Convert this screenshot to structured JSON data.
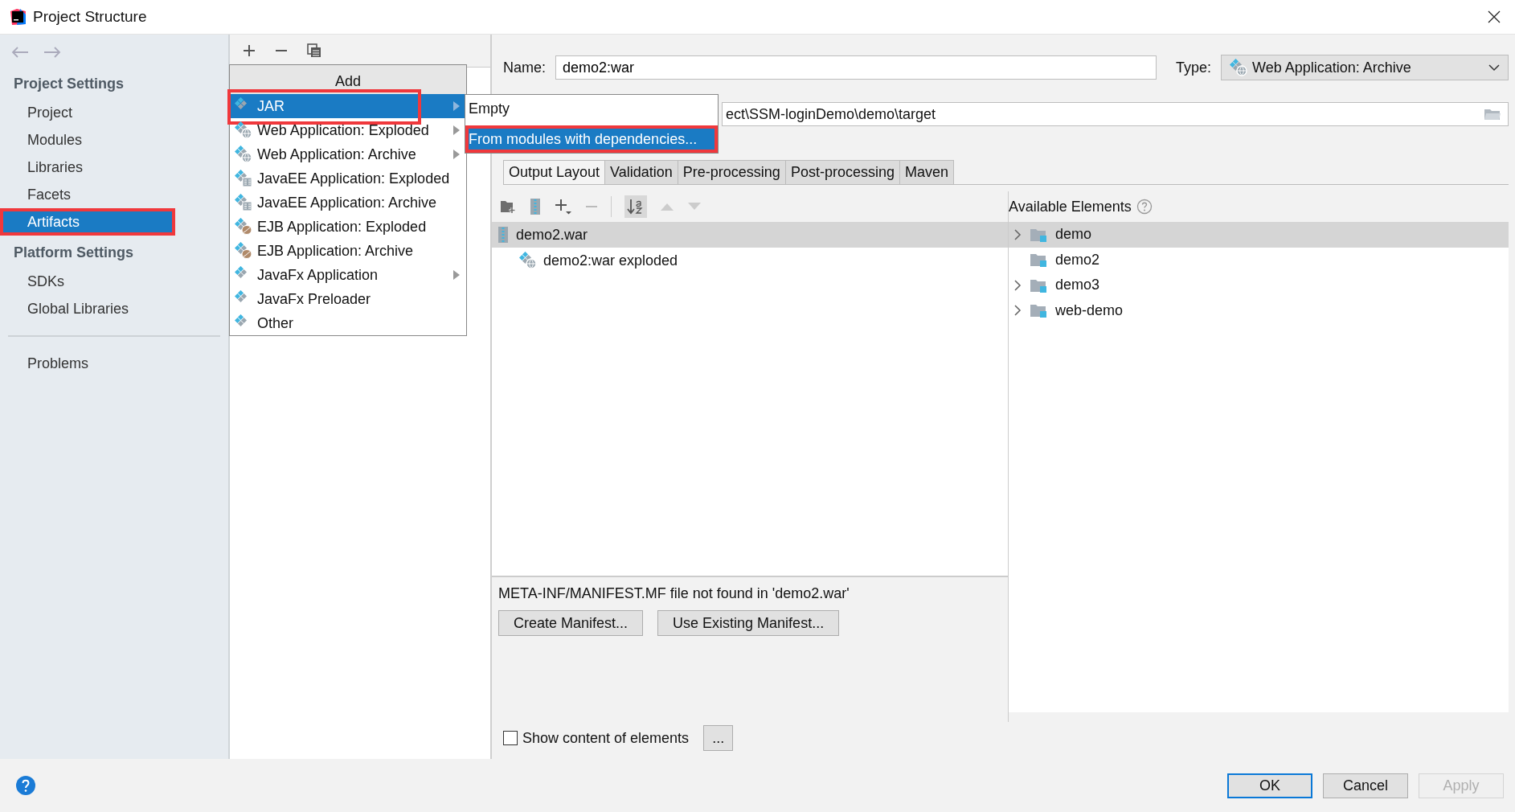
{
  "window": {
    "title": "Project Structure"
  },
  "sidebar": {
    "groups": [
      {
        "heading": "Project Settings",
        "items": [
          {
            "label": "Project",
            "selected": false,
            "highlighted": false
          },
          {
            "label": "Modules",
            "selected": false,
            "highlighted": false
          },
          {
            "label": "Libraries",
            "selected": false,
            "highlighted": false
          },
          {
            "label": "Facets",
            "selected": false,
            "highlighted": false
          },
          {
            "label": "Artifacts",
            "selected": true,
            "highlighted": true
          }
        ]
      },
      {
        "heading": "Platform Settings",
        "items": [
          {
            "label": "SDKs",
            "selected": false,
            "highlighted": false
          },
          {
            "label": "Global Libraries",
            "selected": false,
            "highlighted": false
          }
        ]
      }
    ],
    "footer_items": [
      {
        "label": "Problems",
        "selected": false,
        "highlighted": false
      }
    ]
  },
  "add_popup": {
    "header": "Add",
    "items": [
      {
        "label": "JAR",
        "kind": "jar",
        "submenu": true,
        "selected": true,
        "highlighted": true
      },
      {
        "label": "Web Application: Exploded",
        "kind": "web",
        "submenu": true,
        "selected": false,
        "highlighted": false
      },
      {
        "label": "Web Application: Archive",
        "kind": "web",
        "submenu": true,
        "selected": false,
        "highlighted": false
      },
      {
        "label": "JavaEE Application: Exploded",
        "kind": "javaee",
        "submenu": false,
        "selected": false,
        "highlighted": false
      },
      {
        "label": "JavaEE Application: Archive",
        "kind": "javaee",
        "submenu": false,
        "selected": false,
        "highlighted": false
      },
      {
        "label": "EJB Application: Exploded",
        "kind": "ejb",
        "submenu": false,
        "selected": false,
        "highlighted": false
      },
      {
        "label": "EJB Application: Archive",
        "kind": "ejb",
        "submenu": false,
        "selected": false,
        "highlighted": false
      },
      {
        "label": "JavaFx Application",
        "kind": "jar",
        "submenu": true,
        "selected": false,
        "highlighted": false
      },
      {
        "label": "JavaFx Preloader",
        "kind": "jar",
        "submenu": false,
        "selected": false,
        "highlighted": false
      },
      {
        "label": "Other",
        "kind": "jar",
        "submenu": false,
        "selected": false,
        "highlighted": false
      }
    ]
  },
  "submenu": {
    "items": [
      {
        "label": "Empty",
        "selected": false,
        "highlighted": false
      },
      {
        "label": "From modules with dependencies...",
        "selected": true,
        "highlighted": true
      }
    ]
  },
  "editor": {
    "name_label": "Name:",
    "name_value": "demo2:war",
    "type_label": "Type:",
    "type_value": "Web Application: Archive",
    "output_directory": "ect\\SSM-loginDemo\\demo\\target",
    "tabs": [
      {
        "label": "Output Layout",
        "selected": true
      },
      {
        "label": "Validation",
        "selected": false
      },
      {
        "label": "Pre-processing",
        "selected": false
      },
      {
        "label": "Post-processing",
        "selected": false
      },
      {
        "label": "Maven",
        "selected": false
      }
    ],
    "layout_tree": [
      {
        "label": "demo2.war",
        "kind": "archive",
        "selected": true,
        "children": [
          {
            "label": "demo2:war exploded",
            "kind": "web",
            "selected": false
          }
        ]
      }
    ],
    "available_header": "Available Elements",
    "available": [
      {
        "label": "demo",
        "expandable": true,
        "selected": true
      },
      {
        "label": "demo2",
        "expandable": false,
        "selected": false
      },
      {
        "label": "demo3",
        "expandable": true,
        "selected": false
      },
      {
        "label": "web-demo",
        "expandable": true,
        "selected": false
      }
    ],
    "manifest_message": "META-INF/MANIFEST.MF file not found in 'demo2.war'",
    "manifest_buttons": [
      "Create Manifest...",
      "Use Existing Manifest..."
    ],
    "show_content": {
      "label": "Show content of elements",
      "checked": false
    },
    "more_button": "..."
  },
  "footer": {
    "buttons": [
      {
        "label": "OK",
        "default": true,
        "disabled": false
      },
      {
        "label": "Cancel",
        "default": false,
        "disabled": false
      },
      {
        "label": "Apply",
        "default": false,
        "disabled": true
      }
    ]
  }
}
